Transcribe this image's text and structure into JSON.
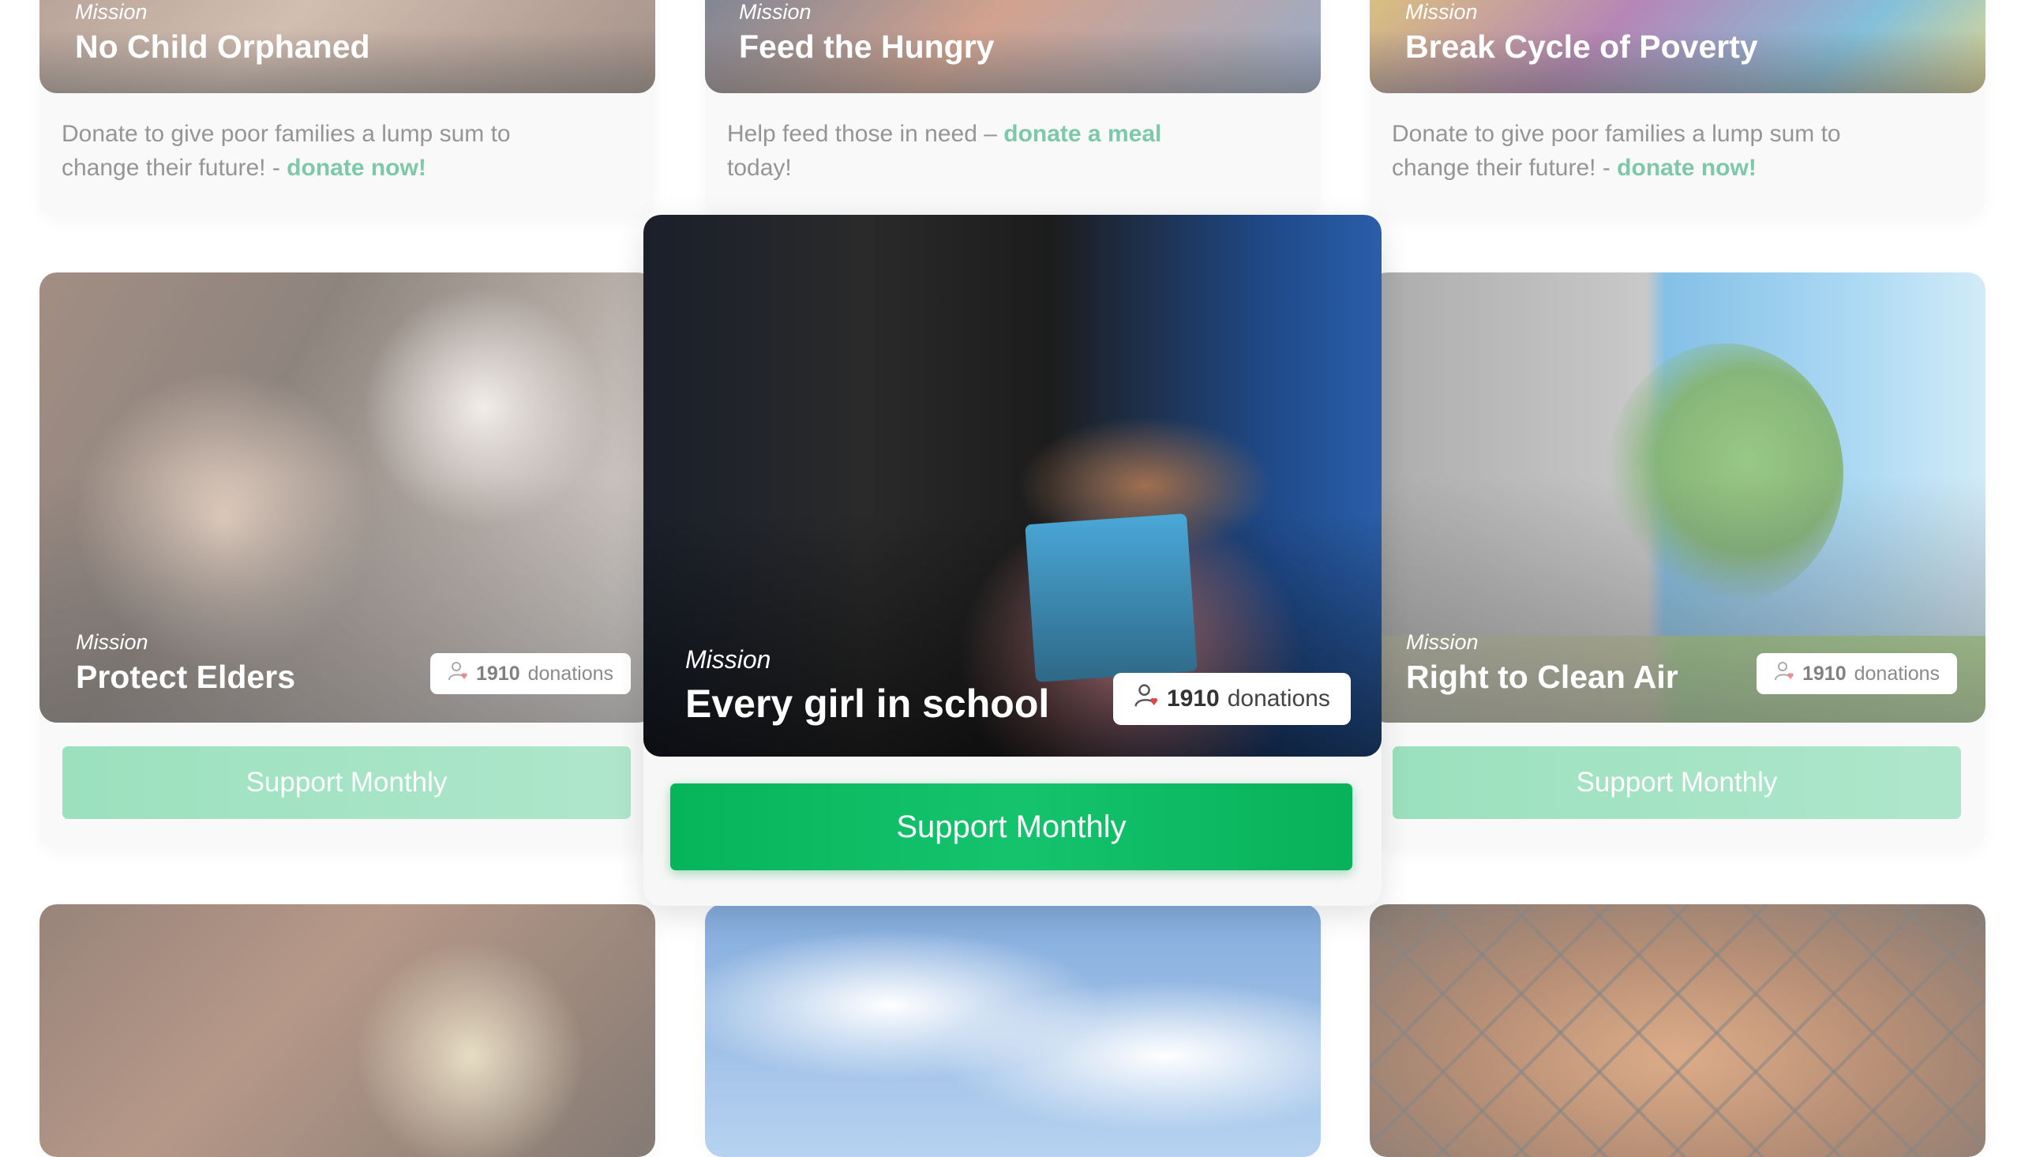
{
  "top_row": [
    {
      "mission_label": "Mission",
      "title": "No Child Orphaned",
      "desc_text": "Donate to give poor families a lump sum to change their future! - ",
      "desc_link": "donate now!"
    },
    {
      "mission_label": "Mission",
      "title": "Feed the Hungry",
      "desc_text": "Help feed those in need – ",
      "desc_link": "donate a meal",
      "desc_tail": " today!"
    },
    {
      "mission_label": "Mission",
      "title": "Break Cycle of Poverty",
      "desc_text": "Donate to give poor families a lump sum to change their future! - ",
      "desc_link": "donate now!"
    }
  ],
  "middle_row": [
    {
      "mission_label": "Mission",
      "title": "Protect Elders",
      "donations_count": "1910",
      "donations_label": "donations",
      "button_label": "Support Monthly"
    },
    {
      "mission_label": "Mission",
      "title": "Every girl in school",
      "donations_count": "1910",
      "donations_label": "donations",
      "button_label": "Support Monthly"
    },
    {
      "mission_label": "Mission",
      "title": "Right to Clean Air",
      "donations_count": "1910",
      "donations_label": "donations",
      "button_label": "Support Monthly"
    }
  ],
  "colors": {
    "accent": "#14c46d",
    "link": "#2fa876"
  },
  "icons": {
    "donor": "person-heart-icon"
  }
}
